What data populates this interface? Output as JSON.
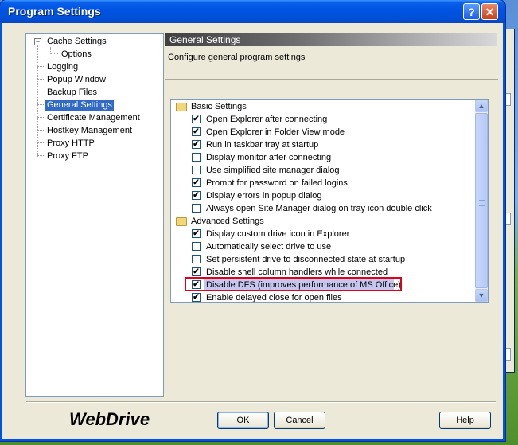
{
  "window": {
    "title": "Program Settings",
    "help_glyph": "?",
    "close_glyph": "✕"
  },
  "tree": {
    "items": [
      {
        "label": "Cache Settings",
        "expander": "−"
      },
      {
        "label": "Options"
      },
      {
        "label": "Logging"
      },
      {
        "label": "Popup Window"
      },
      {
        "label": "Backup Files"
      },
      {
        "label": "General Settings",
        "selected": true
      },
      {
        "label": "Certificate Management"
      },
      {
        "label": "Hostkey Management"
      },
      {
        "label": "Proxy HTTP"
      },
      {
        "label": "Proxy FTP"
      }
    ]
  },
  "panel": {
    "header": "General Settings",
    "description": "Configure general program settings"
  },
  "settings": {
    "basic": {
      "label": "Basic Settings",
      "items": [
        {
          "label": "Open Explorer after connecting",
          "checked": true
        },
        {
          "label": "Open Explorer in Folder View mode",
          "checked": true
        },
        {
          "label": "Run in taskbar tray at startup",
          "checked": true
        },
        {
          "label": "Display monitor after connecting",
          "checked": false
        },
        {
          "label": "Use simplified site manager dialog",
          "checked": false
        },
        {
          "label": "Prompt for password on failed logins",
          "checked": true
        },
        {
          "label": "Display errors in popup dialog",
          "checked": true
        },
        {
          "label": "Always open Site Manager dialog on tray icon double click",
          "checked": false
        }
      ]
    },
    "advanced": {
      "label": "Advanced Settings",
      "items": [
        {
          "label": "Display custom drive icon in Explorer",
          "checked": true
        },
        {
          "label": "Automatically select drive to use",
          "checked": false
        },
        {
          "label": "Set persistent drive to disconnected state at startup",
          "checked": false
        },
        {
          "label": "Disable shell column handlers while connected",
          "checked": true
        },
        {
          "label": "Disable DFS (improves performance of MS Office)",
          "checked": true,
          "highlighted": true
        },
        {
          "label": "Enable delayed close for open files",
          "checked": true
        }
      ]
    },
    "check_glyph": "✔"
  },
  "scrollbar": {
    "up_glyph": "▲",
    "down_glyph": "▼"
  },
  "footer": {
    "logo": "WebDrive",
    "ok": "OK",
    "cancel": "Cancel",
    "help": "Help"
  },
  "colors": {
    "title_bar": "#0054e3",
    "selection": "#316ac5",
    "highlight_border": "#e0001b"
  }
}
